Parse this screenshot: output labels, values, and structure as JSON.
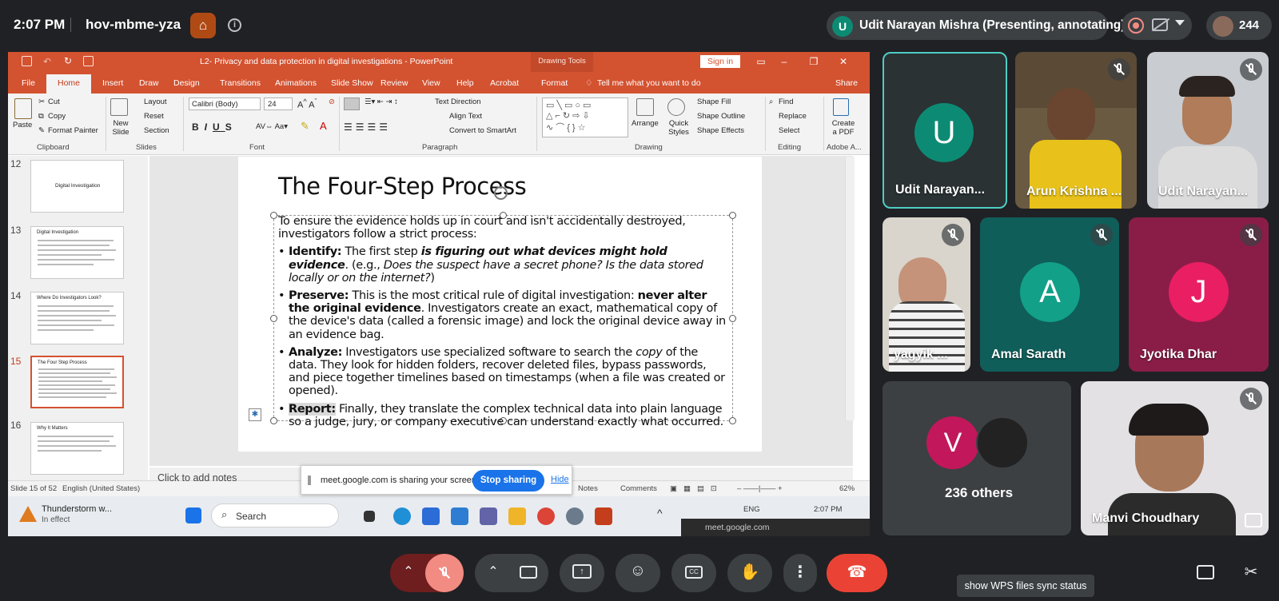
{
  "meet": {
    "time": "2:07 PM",
    "meeting_code": "hov-mbme-yza",
    "presenter_initial": "U",
    "presenter_label": "Udit Narayan Mishra (Presenting, annotating)",
    "participant_count": "244"
  },
  "ppt": {
    "doc_title": "L2- Privacy and data protection in digital investigations  -  PowerPoint",
    "drawing_tools": "Drawing Tools",
    "sign_in": "Sign in",
    "tabs": [
      "File",
      "Home",
      "Insert",
      "Draw",
      "Design",
      "Transitions",
      "Animations",
      "Slide Show",
      "Review",
      "View",
      "Help",
      "Acrobat",
      "Format"
    ],
    "tell_me": "Tell me what you want to do",
    "share": "Share",
    "ribbon": {
      "paste": "Paste",
      "cut": "Cut",
      "copy": "Copy",
      "format_painter": "Format Painter",
      "clipboard": "Clipboard",
      "new_slide": "New Slide",
      "layout": "Layout",
      "reset": "Reset",
      "section": "Section",
      "slides": "Slides",
      "font_name": "Calibri (Body)",
      "font_size": "24",
      "font": "Font",
      "text_direction": "Text Direction",
      "align_text": "Align Text",
      "convert_smartart": "Convert to SmartArt",
      "paragraph": "Paragraph",
      "arrange": "Arrange",
      "quick_styles": "Quick Styles",
      "shape_fill": "Shape Fill",
      "shape_outline": "Shape Outline",
      "shape_effects": "Shape Effects",
      "drawing": "Drawing",
      "find": "Find",
      "replace": "Replace",
      "select": "Select",
      "editing": "Editing",
      "create_pdf": "Create a PDF",
      "adobe": "Adobe A..."
    },
    "thumbnails": [
      {
        "num": "12",
        "title": "Digital Investigation"
      },
      {
        "num": "13",
        "title": "Digital Investigation"
      },
      {
        "num": "14",
        "title": "Where Do Investigators Look?"
      },
      {
        "num": "15",
        "title": "The Four Step Process"
      },
      {
        "num": "16",
        "title": "Why It Matters"
      }
    ],
    "slide": {
      "title": "The Four-Step Process",
      "intro": "To ensure the evidence holds up in court and isn't accidentally destroyed, investigators follow a strict process:",
      "b1_label": "Identify:",
      "b1_text1": " The first step ",
      "b1_bolditalic": "is figuring out what devices might hold evidence",
      "b1_text2": ". (e.g., ",
      "b1_italic": "Does the suspect have a secret phone? Is the data stored locally or on the internet?",
      "b1_text3": ")",
      "b2_label": "Preserve:",
      "b2_text1": " This is the most critical rule of digital investigation: ",
      "b2_bold": "never alter the original evidence",
      "b2_text2": ". Investigators create an exact, mathematical copy of the device's data (called a forensic image) and lock the original device away in an evidence bag.",
      "b3_label": "Analyze:",
      "b3_text1": " Investigators use specialized software to search the ",
      "b3_italic": "copy",
      "b3_text2": " of the data. They look for hidden folders, recover deleted files, bypass passwords, and piece together timelines based on timestamps (when a file was created or opened).",
      "b4_label": "Report:",
      "b4_text": " Finally, they translate the complex technical data into plain language so a judge, jury, or company executive can understand exactly what occurred."
    },
    "notes_placeholder": "Click to add notes",
    "status": {
      "slide": "Slide 15 of 52",
      "language": "English (United States)",
      "notes": "Notes",
      "comments": "Comments",
      "zoom": "62%"
    }
  },
  "share_banner": {
    "text": "meet.google.com is sharing your screen.",
    "stop": "Stop sharing",
    "hide": "Hide"
  },
  "taskbar": {
    "weather": "Thunderstorm w...",
    "weather_sub": "In effect",
    "search": "Search",
    "lang": "ENG",
    "time": "2:07 PM",
    "tooltip": "meet.google.com"
  },
  "tiles": [
    {
      "name": "Udit Narayan...",
      "initial": "U",
      "color": "#0d8a74"
    },
    {
      "name": "Arun Krishna ..."
    },
    {
      "name": "Udit Narayan..."
    },
    {
      "name": "yagyik ..."
    },
    {
      "name": "Amal Sarath",
      "initial": "A",
      "color": "#12a089"
    },
    {
      "name": "Jyotika Dhar",
      "initial": "J",
      "color": "#d81b60"
    },
    {
      "name": "236 others",
      "initial": "V",
      "color": "#c2185b"
    },
    {
      "name": "Manvi Choudhary"
    }
  ],
  "tooltip_wps": "show WPS files sync status",
  "colors": {
    "ppt_accent": "#d35230",
    "meet_bg": "#202124",
    "end_call": "#ea4335",
    "mic_off": "#ea4335"
  }
}
